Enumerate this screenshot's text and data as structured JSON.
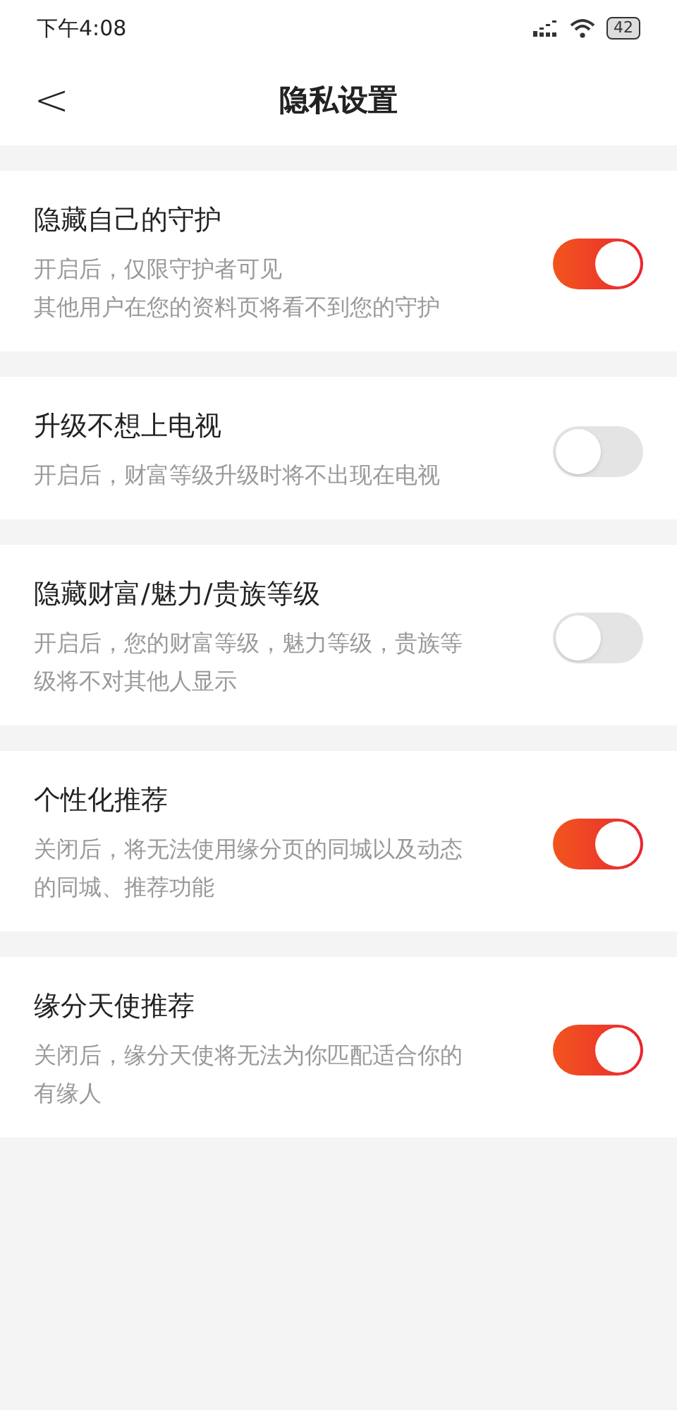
{
  "status_bar": {
    "time": "下午4:08",
    "battery": "42"
  },
  "header": {
    "back": "<",
    "title": "隐私设置"
  },
  "settings": [
    {
      "title": "隐藏自己的守护",
      "description_lines": [
        "开启后，仅限守护者可见",
        "其他用户在您的资料页将看不到您的守护"
      ],
      "on": true
    },
    {
      "title": "升级不想上电视",
      "description_lines": [
        "开启后，财富等级升级时将不出现在电视"
      ],
      "on": false
    },
    {
      "title": "隐藏财富/魅力/贵族等级",
      "description_lines": [
        "开启后，您的财富等级，魅力等级，贵族等",
        "级将不对其他人显示"
      ],
      "on": false
    },
    {
      "title": "个性化推荐",
      "description_lines": [
        "关闭后，将无法使用缘分页的同城以及动态",
        "的同城、推荐功能"
      ],
      "on": true
    },
    {
      "title": "缘分天使推荐",
      "description_lines": [
        "关闭后，缘分天使将无法为你匹配适合你的",
        "有缘人"
      ],
      "on": true
    }
  ]
}
